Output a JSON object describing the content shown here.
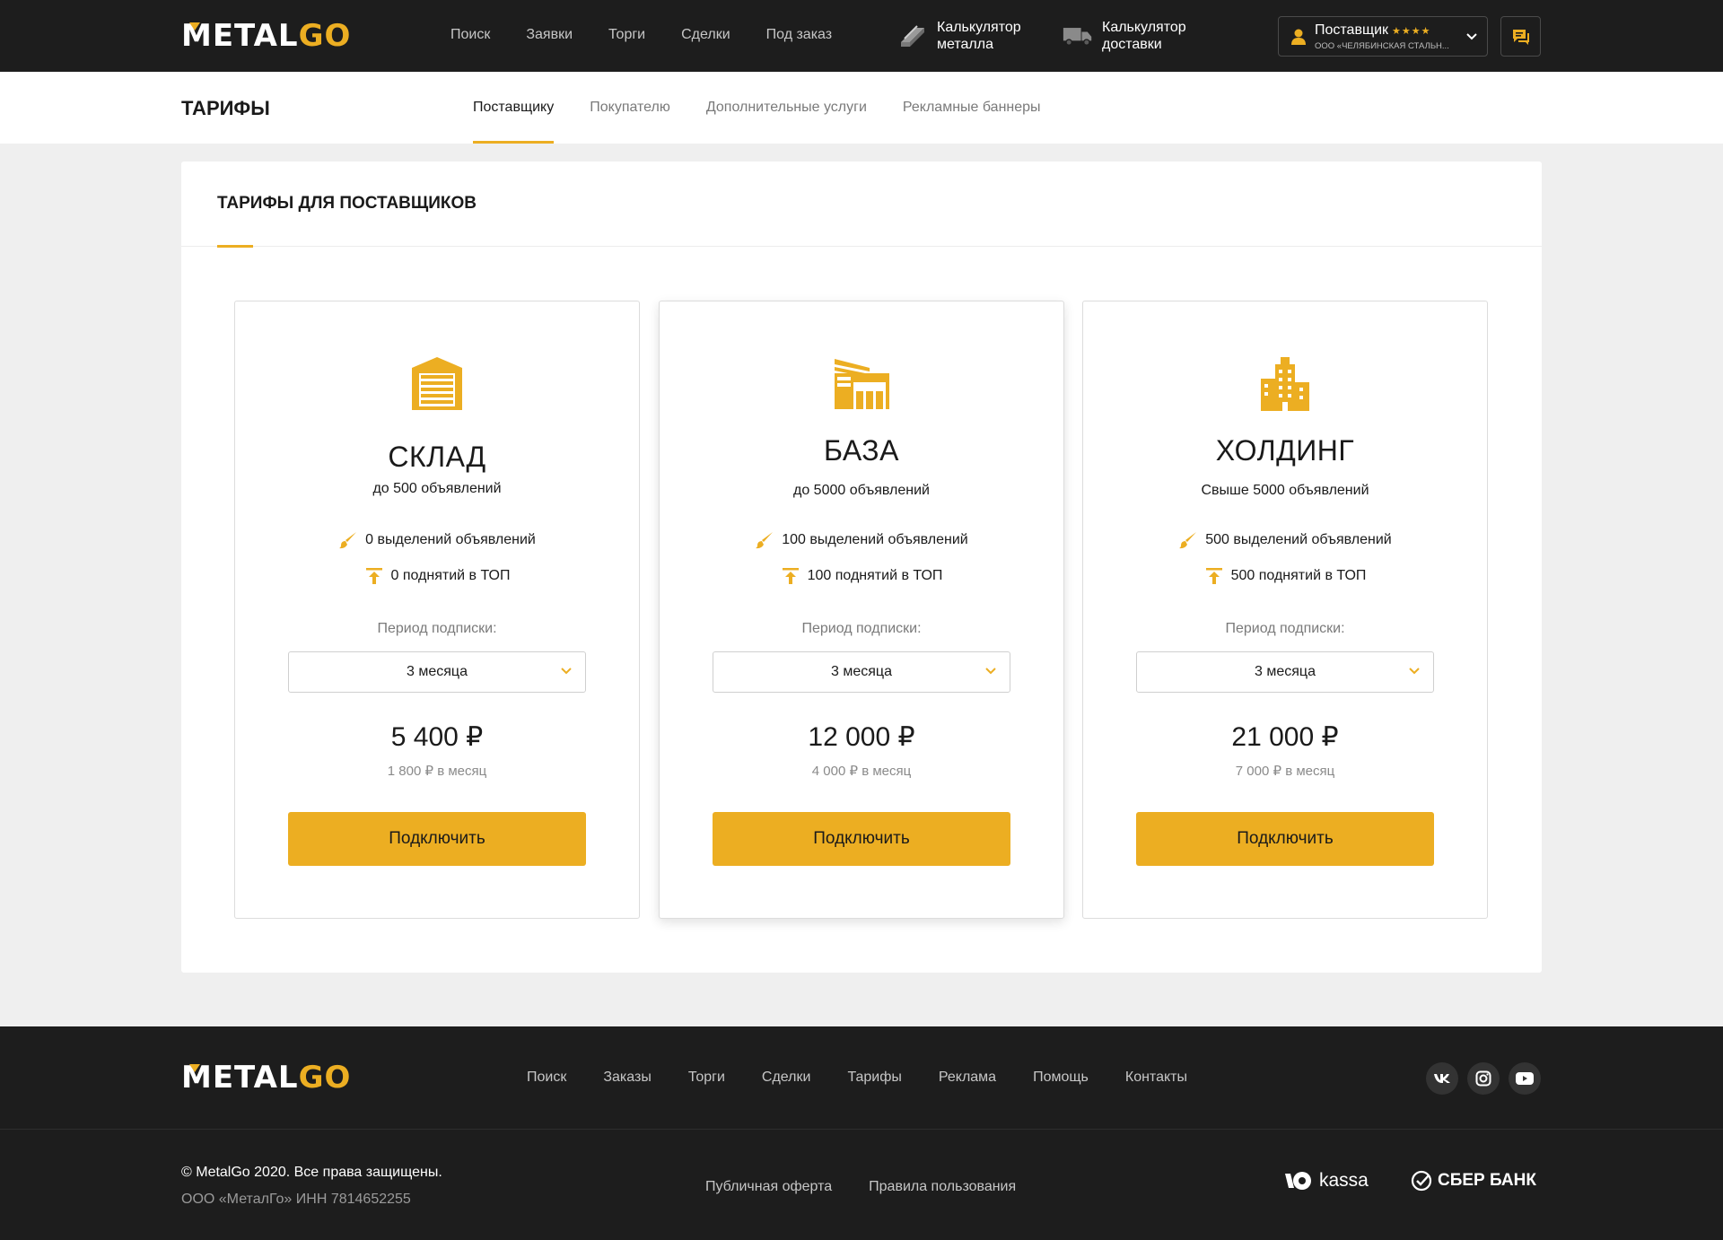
{
  "header": {
    "logo": {
      "part1": "METAL",
      "part2": "GO"
    },
    "nav": [
      "Поиск",
      "Заявки",
      "Торги",
      "Сделки",
      "Под заказ"
    ],
    "calc_metal": {
      "line1": "Калькулятор",
      "line2": "металла",
      "icon": "steel-beam-icon"
    },
    "calc_delivery": {
      "line1": "Калькулятор",
      "line2": "доставки",
      "icon": "truck-icon"
    },
    "user": {
      "role": "Поставщик",
      "stars": "★★★★",
      "company": "ООО «ЧЕЛЯБИНСКАЯ СТАЛЬН..."
    },
    "messages_icon": "chat-icon"
  },
  "subheader": {
    "title": "ТАРИФЫ",
    "tabs": [
      "Поставщику",
      "Покупателю",
      "Дополнительные услуги",
      "Рекламные баннеры"
    ],
    "active_tab": "Поставщику"
  },
  "main": {
    "title": "ТАРИФЫ ДЛЯ ПОСТАВЩИКОВ",
    "plans": [
      {
        "name": "СКЛАД",
        "limit": "до 500 объявлений",
        "highlights": "0 выделений объявлений",
        "top": "0 поднятий в ТОП",
        "period_label": "Период подписки:",
        "period": "3 месяца",
        "price": "5 400 ₽",
        "monthly": "1 800 ₽ в месяц",
        "button": "Подключить",
        "icon": "warehouse-icon"
      },
      {
        "name": "БАЗА",
        "limit": "до 5000 объявлений",
        "highlights": "100 выделений объявлений",
        "top": "100 поднятий в ТОП",
        "period_label": "Период подписки:",
        "period": "3 месяца",
        "price": "12 000 ₽",
        "monthly": "4 000 ₽ в месяц",
        "button": "Подключить",
        "icon": "base-building-icon"
      },
      {
        "name": "ХОЛДИНГ",
        "limit": "Свыше 5000 объявлений",
        "highlights": "500 выделений объявлений",
        "top": "500 поднятий в ТОП",
        "period_label": "Период подписки:",
        "period": "3 месяца",
        "price": "21 000 ₽",
        "monthly": "7 000 ₽ в месяц",
        "button": "Подключить",
        "icon": "skyscraper-icon"
      }
    ]
  },
  "footer": {
    "logo": {
      "part1": "METAL",
      "part2": "GO"
    },
    "nav": [
      "Поиск",
      "Заказы",
      "Торги",
      "Сделки",
      "Тарифы",
      "Реклама",
      "Помощь",
      "Контакты"
    ],
    "socials": [
      "vk-icon",
      "instagram-icon",
      "youtube-icon"
    ],
    "copyright": "© MetalGo 2020. Все права защищены.",
    "company": "ООО «МеталГо» ИНН 7814652255",
    "legal": [
      "Публичная оферта",
      "Правила пользования"
    ],
    "payments": {
      "kassa": "kassa",
      "sber": "СБЕР БАНК"
    }
  },
  "colors": {
    "accent": "#ecae22",
    "dark": "#1d1d1d",
    "background": "#efefef"
  }
}
